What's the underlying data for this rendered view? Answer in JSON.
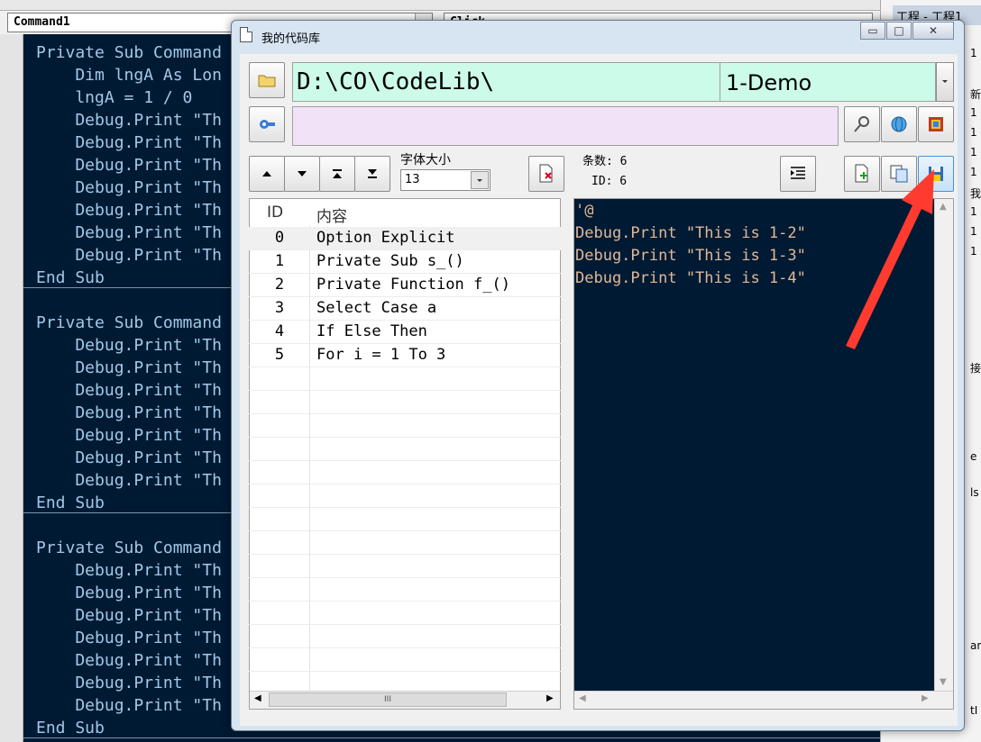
{
  "ide": {
    "proc_combo": "Command1",
    "obj_combo": "Click",
    "right_title": "工程 - 工程1",
    "right_fragments": [
      "1",
      "新",
      "1",
      "1",
      "1",
      "1",
      "我",
      "1",
      "1",
      "1",
      "接",
      "e",
      "ls",
      "ar",
      "tI"
    ]
  },
  "code_blocks": [
    {
      "header": "Private Sub Command",
      "lines": [
        "    Dim lngA As Lon",
        "    lngA = 1 / 0",
        "    Debug.Print \"Th",
        "    Debug.Print \"Th",
        "    Debug.Print \"Th",
        "    Debug.Print \"Th",
        "    Debug.Print \"Th",
        "    Debug.Print \"Th",
        "    Debug.Print \"Th"
      ],
      "footer": "End Sub"
    },
    {
      "header": "Private Sub Command",
      "lines": [
        "    Debug.Print \"Th",
        "    Debug.Print \"Th",
        "    Debug.Print \"Th",
        "    Debug.Print \"Th",
        "    Debug.Print \"Th",
        "    Debug.Print \"Th",
        "    Debug.Print \"Th"
      ],
      "footer": "End Sub"
    },
    {
      "header": "Private Sub Command",
      "lines": [
        "    Debug.Print \"Th",
        "    Debug.Print \"Th",
        "    Debug.Print \"Th",
        "    Debug.Print \"Th",
        "    Debug.Print \"Th",
        "    Debug.Print \"Th",
        "    Debug.Print \"Th"
      ],
      "footer": "End Sub"
    }
  ],
  "dialog": {
    "title": "我的代码库",
    "path": "D:\\CO\\CodeLib\\",
    "library": "1-Demo",
    "search_value": "",
    "font_size_label": "字体大小",
    "font_size_value": "13",
    "count_text": "条数: 6",
    "id_text": "ID: 6",
    "list_headers": {
      "id": "ID",
      "content": "内容"
    },
    "list_rows": [
      {
        "id": "0",
        "content": "Option Explicit"
      },
      {
        "id": "1",
        "content": "Private Sub s_()"
      },
      {
        "id": "2",
        "content": "Private Function f_()"
      },
      {
        "id": "3",
        "content": "Select Case a"
      },
      {
        "id": "4",
        "content": "If Else Then"
      },
      {
        "id": "5",
        "content": "For i = 1 To 3"
      }
    ],
    "preview_lines": [
      "'@",
      "Debug.Print \"This is 1-2\"",
      "Debug.Print \"This is 1-3\"",
      "Debug.Print \"This is 1-4\""
    ],
    "hscroll_glyph": "III",
    "accent": "#ff3b30"
  }
}
